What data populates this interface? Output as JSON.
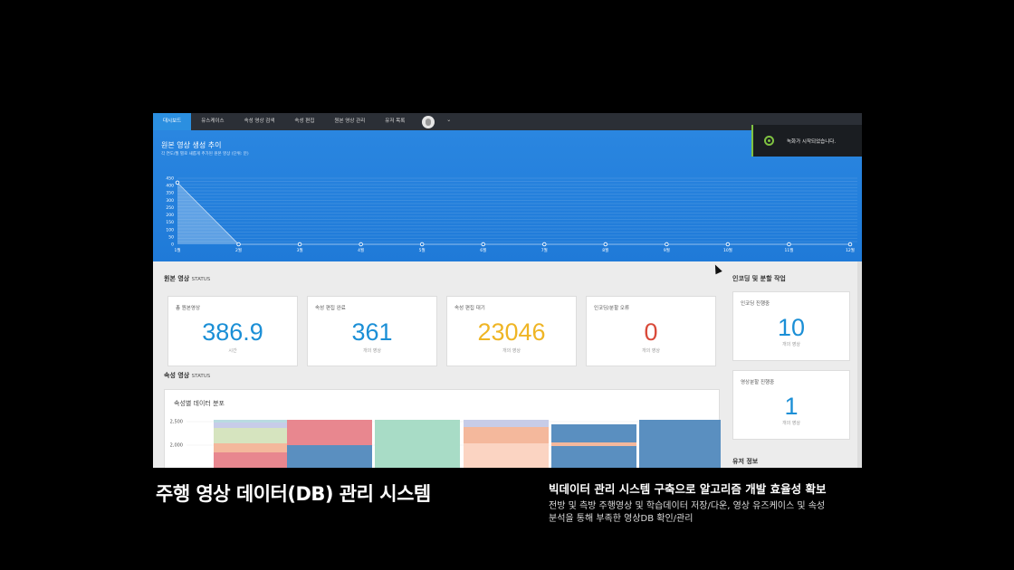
{
  "nav": {
    "items": [
      "대시보드",
      "유스케이스",
      "속성 영상 검색",
      "속성 편집",
      "원본 영상 관리",
      "유저 목록"
    ],
    "active_index": 0,
    "avatar_icon": "user-avatar-icon",
    "caret_icon": "chevron-down-icon"
  },
  "hero": {
    "title": "원본 영상 생성 추이",
    "subtitle": "각 연도/월 별로 새롭게 추가된 원본 영상 (단위: 분)"
  },
  "toast": {
    "icon": "recording-icon",
    "text": "녹화가 시작되었습니다."
  },
  "chart_data": [
    {
      "type": "area",
      "x": [
        "1월",
        "2월",
        "3월",
        "4월",
        "5월",
        "6월",
        "7월",
        "8월",
        "9월",
        "10월",
        "11월",
        "12월"
      ],
      "series": [
        {
          "values": [
            420,
            0,
            0,
            0,
            0,
            0,
            0,
            0,
            0,
            0,
            0,
            0
          ]
        }
      ],
      "yticks": [
        "450",
        "400",
        "350",
        "300",
        "250",
        "200",
        "150",
        "100",
        "50",
        "0"
      ],
      "ylim": [
        0,
        450
      ],
      "grid": true
    },
    {
      "type": "bar",
      "stacked": true,
      "yticks": [
        "2,500",
        "2,000"
      ],
      "colors": [
        "#e8878f",
        "#5a8fc0",
        "#a8dcc6",
        "#f4b89c",
        "#fbd4c2",
        "#c7cce8",
        "#d6e4bf",
        "#b9dbe0"
      ],
      "note": "bars partially visible (cropped)"
    }
  ],
  "status": {
    "title": "원본 영상",
    "title_suffix": "STATUS",
    "cards": [
      {
        "label": "총 원본영상",
        "value": "386.9",
        "unit": "시간",
        "color": "#1b8fd6"
      },
      {
        "label": "속성 편집 완료",
        "value": "361",
        "unit": "개의 영상",
        "color": "#1b8fd6"
      },
      {
        "label": "속성 편집 대기",
        "value": "23046",
        "unit": "개의 영상",
        "color": "#efb525"
      },
      {
        "label": "인코딩/분할 오류",
        "value": "0",
        "unit": "개의 영상",
        "color": "#d94a3a"
      }
    ]
  },
  "attr": {
    "title": "속성 영상",
    "title_suffix": "STATUS",
    "panel_title": "속성별 데이터 분포"
  },
  "side": {
    "title": "인코딩 및 분할 작업",
    "cards": [
      {
        "label": "인코딩 진행중",
        "value": "10",
        "unit": "개의 영상"
      },
      {
        "label": "영상분할 진행중",
        "value": "1",
        "unit": "개의 영상"
      }
    ],
    "user_title": "유저 정보"
  },
  "captions": {
    "main": "주행 영상 데이터(DB) 관리 시스템",
    "headline": "빅데이터 관리 시스템 구축으로 알고리즘 개발 효율성 확보",
    "desc_line1": "전방 및 측방 주행영상 및 학습데이터 저장/다운, 영상 유즈케이스 및 속성",
    "desc_line2": "분석을 통해 부족한 영상DB 확인/관리"
  }
}
